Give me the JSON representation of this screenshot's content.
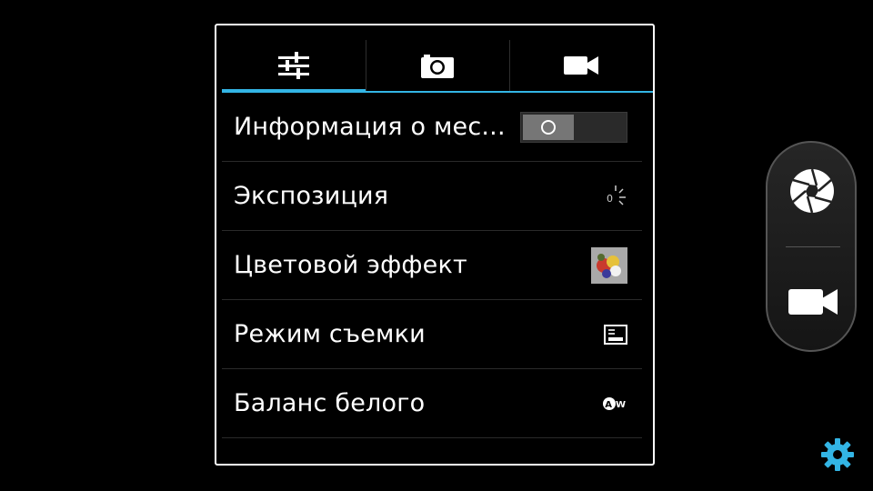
{
  "tabs": [
    {
      "icon": "sliders-icon",
      "active": true
    },
    {
      "icon": "camera-icon",
      "active": false
    },
    {
      "icon": "video-camera-icon",
      "active": false
    }
  ],
  "settings": {
    "location": {
      "label": "Информация о мес...",
      "toggle": "off"
    },
    "exposure": {
      "label": "Экспозиция",
      "value": "0"
    },
    "color_effect": {
      "label": "Цветовой эффект"
    },
    "scene_mode": {
      "label": "Режим съемки"
    },
    "white_balance": {
      "label": "Баланс белого",
      "value": "AW"
    }
  },
  "accent_color": "#33b5e5",
  "gear_color": "#33b5e5"
}
